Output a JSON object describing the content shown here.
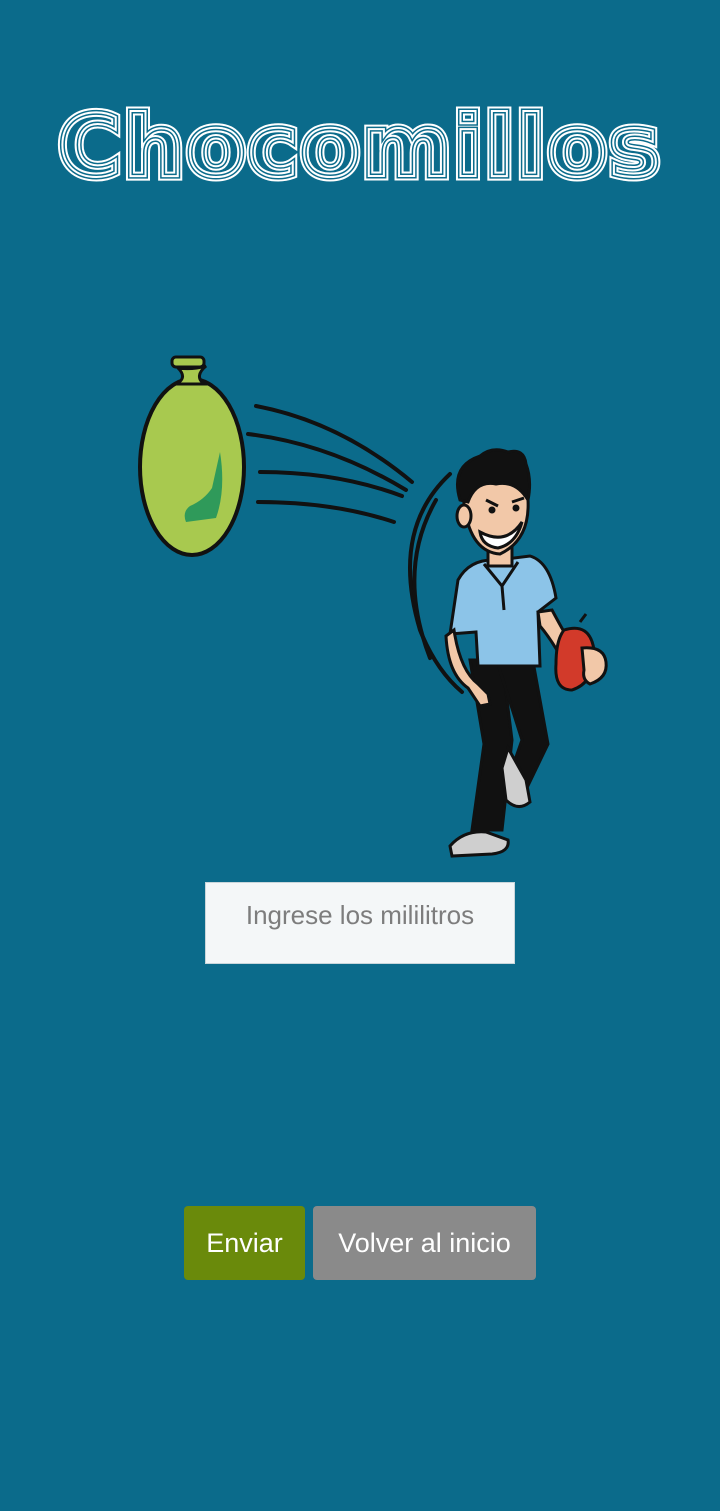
{
  "app": {
    "title": "Chocomillos"
  },
  "form": {
    "ml_placeholder": "Ingrese los mililitros",
    "ml_value": ""
  },
  "actions": {
    "send_label": "Enviar",
    "home_label": "Volver al inicio"
  },
  "colors": {
    "background": "#0b6b8b",
    "send_button": "#6a8a0b",
    "home_button": "#8a8a8a",
    "title": "#ffffff"
  },
  "illustration": {
    "icon": "man-throwing-water-balloon-icon"
  }
}
